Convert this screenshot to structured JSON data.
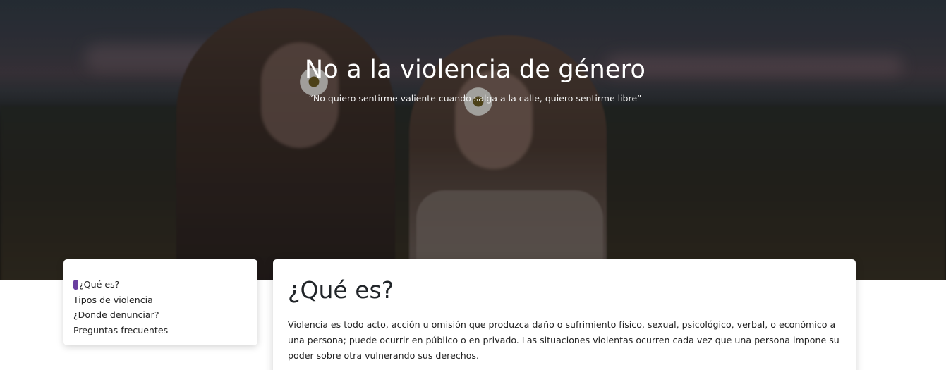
{
  "hero": {
    "title": "No a la violencia de género",
    "quote": "“No quiero sentirme valiente cuando salga a la calle, quiero sentirme libre”"
  },
  "toc": {
    "items": [
      {
        "label": "¿Qué es?",
        "active": true
      },
      {
        "label": "Tipos de violencia",
        "active": false
      },
      {
        "label": "¿Donde denunciar?",
        "active": false
      },
      {
        "label": "Preguntas frecuentes",
        "active": false
      }
    ],
    "accent_color": "#6a3fa0"
  },
  "section": {
    "title": "¿Qué es?",
    "paragraph": "Violencia es todo acto, acción u omisión que produzca daño o sufrimiento físico, sexual, psicológico, verbal, o económico a una persona; puede ocurrir en público o en privado. Las situaciones violentas ocurren cada vez que una persona impone su poder sobre otra vulnerando sus derechos."
  }
}
